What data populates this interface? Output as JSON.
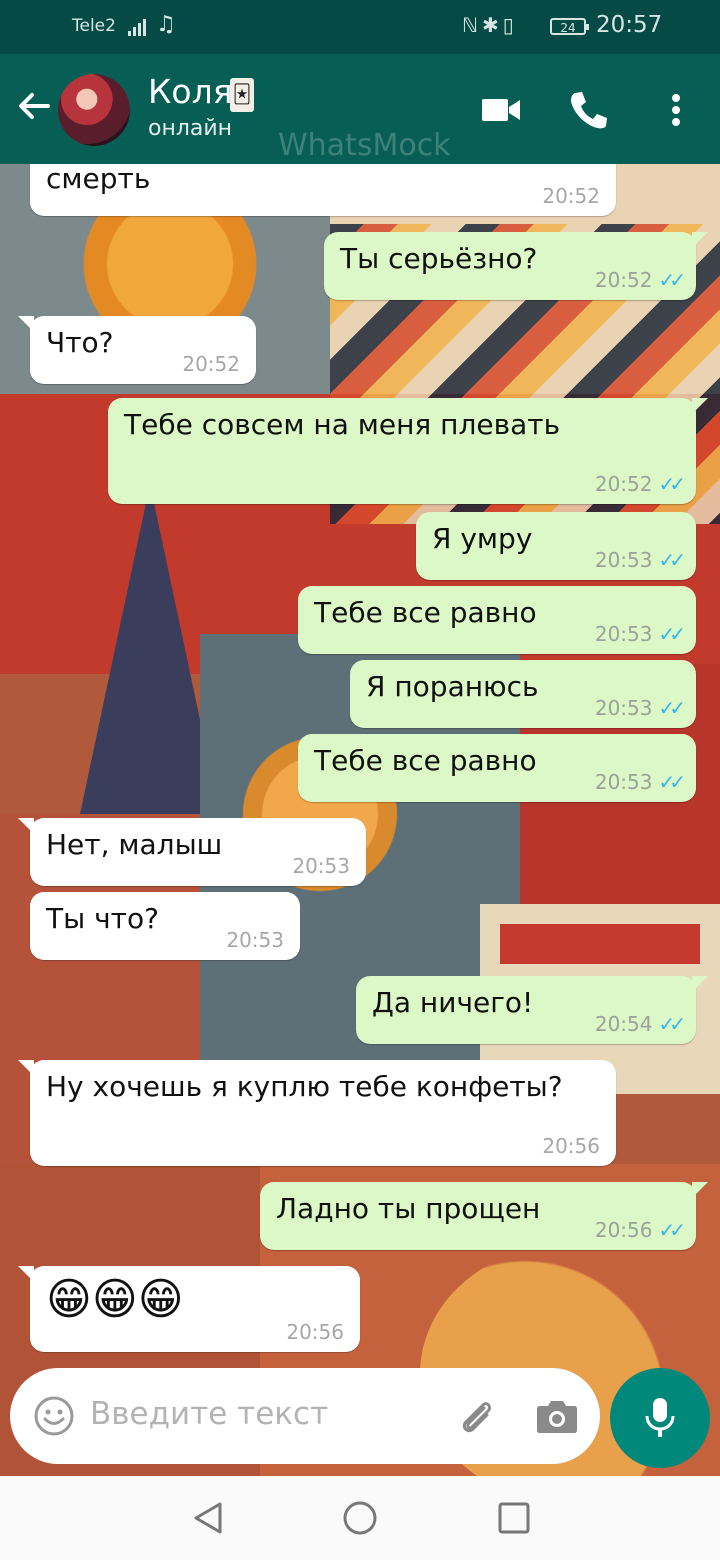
{
  "status_bar": {
    "carrier": "Tele2",
    "battery": "24",
    "time": "20:57"
  },
  "header": {
    "contact_name": "Коля",
    "contact_status": "онлайн",
    "watermark": "WhatsMock",
    "avatar_icon": "avatar-anime-character",
    "icons": [
      "back-arrow-icon",
      "video-call-icon",
      "phone-call-icon",
      "more-menu-icon"
    ]
  },
  "messages": [
    {
      "dir": "in",
      "text": "смерть",
      "time": "20:52"
    },
    {
      "dir": "out",
      "text": "Ты серьёзно?",
      "time": "20:52",
      "status": "read"
    },
    {
      "dir": "in",
      "text": "Что?",
      "time": "20:52"
    },
    {
      "dir": "out",
      "text": "Тебе совсем на меня плевать",
      "time": "20:52",
      "status": "read"
    },
    {
      "dir": "out",
      "text": "Я умру",
      "time": "20:53",
      "status": "read"
    },
    {
      "dir": "out",
      "text": "Тебе все равно",
      "time": "20:53",
      "status": "read"
    },
    {
      "dir": "out",
      "text": "Я поранюсь",
      "time": "20:53",
      "status": "read"
    },
    {
      "dir": "out",
      "text": "Тебе все равно",
      "time": "20:53",
      "status": "read"
    },
    {
      "dir": "in",
      "text": "Нет, малыш",
      "time": "20:53"
    },
    {
      "dir": "in",
      "text": "Ты что?",
      "time": "20:53"
    },
    {
      "dir": "out",
      "text": "Да ничего!",
      "time": "20:54",
      "status": "read"
    },
    {
      "dir": "in",
      "text": "Ну хочешь я куплю тебе конфеты?",
      "time": "20:56"
    },
    {
      "dir": "out",
      "text": "Ладно ты прощен",
      "time": "20:56",
      "status": "read"
    },
    {
      "dir": "in",
      "text": "😁😁😁",
      "time": "20:56"
    }
  ],
  "input_bar": {
    "placeholder": "Введите текст"
  },
  "colors": {
    "header": "#075e54",
    "status_bar": "#054a44",
    "outgoing_bubble": "#dcf8c6",
    "incoming_bubble": "#ffffff",
    "read_ticks": "#34b7f1",
    "mic_button": "#00897b"
  }
}
